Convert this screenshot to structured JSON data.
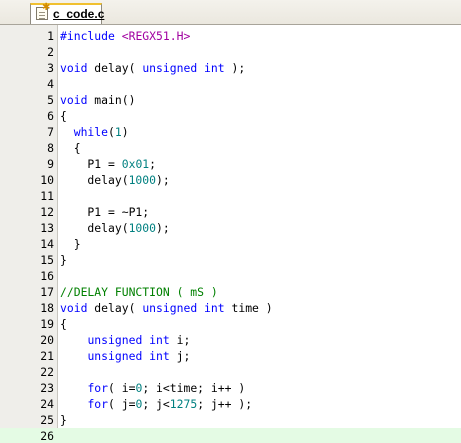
{
  "tab": {
    "label": "c_code.c"
  },
  "editor": {
    "current_line": 26,
    "lines": [
      {
        "n": "1",
        "tokens": [
          [
            "pp",
            "#include "
          ],
          [
            "str",
            "<REGX51.H>"
          ]
        ]
      },
      {
        "n": "2",
        "tokens": []
      },
      {
        "n": "3",
        "tokens": [
          [
            "kw",
            "void"
          ],
          [
            "txt",
            " delay( "
          ],
          [
            "kw",
            "unsigned"
          ],
          [
            "txt",
            " "
          ],
          [
            "kw",
            "int"
          ],
          [
            "txt",
            " );"
          ]
        ]
      },
      {
        "n": "4",
        "tokens": []
      },
      {
        "n": "5",
        "tokens": [
          [
            "kw",
            "void"
          ],
          [
            "txt",
            " main()"
          ]
        ]
      },
      {
        "n": "6",
        "tokens": [
          [
            "txt",
            "{"
          ]
        ]
      },
      {
        "n": "7",
        "tokens": [
          [
            "txt",
            "  "
          ],
          [
            "kw",
            "while"
          ],
          [
            "txt",
            "("
          ],
          [
            "num",
            "1"
          ],
          [
            "txt",
            ")"
          ]
        ]
      },
      {
        "n": "8",
        "tokens": [
          [
            "txt",
            "  {"
          ]
        ]
      },
      {
        "n": "9",
        "tokens": [
          [
            "txt",
            "    P1 = "
          ],
          [
            "num",
            "0x01"
          ],
          [
            "txt",
            ";"
          ]
        ]
      },
      {
        "n": "10",
        "tokens": [
          [
            "txt",
            "    delay("
          ],
          [
            "num",
            "1000"
          ],
          [
            "txt",
            ");"
          ]
        ]
      },
      {
        "n": "11",
        "tokens": []
      },
      {
        "n": "12",
        "tokens": [
          [
            "txt",
            "    P1 = ~P1;"
          ]
        ]
      },
      {
        "n": "13",
        "tokens": [
          [
            "txt",
            "    delay("
          ],
          [
            "num",
            "1000"
          ],
          [
            "txt",
            ");"
          ]
        ]
      },
      {
        "n": "14",
        "tokens": [
          [
            "txt",
            "  }"
          ]
        ]
      },
      {
        "n": "15",
        "tokens": [
          [
            "txt",
            "}"
          ]
        ]
      },
      {
        "n": "16",
        "tokens": []
      },
      {
        "n": "17",
        "tokens": [
          [
            "cmt",
            "//DELAY FUNCTION ( mS )"
          ]
        ]
      },
      {
        "n": "18",
        "tokens": [
          [
            "kw",
            "void"
          ],
          [
            "txt",
            " delay( "
          ],
          [
            "kw",
            "unsigned"
          ],
          [
            "txt",
            " "
          ],
          [
            "kw",
            "int"
          ],
          [
            "txt",
            " time )"
          ]
        ]
      },
      {
        "n": "19",
        "tokens": [
          [
            "txt",
            "{"
          ]
        ]
      },
      {
        "n": "20",
        "tokens": [
          [
            "txt",
            "    "
          ],
          [
            "kw",
            "unsigned"
          ],
          [
            "txt",
            " "
          ],
          [
            "kw",
            "int"
          ],
          [
            "txt",
            " i;"
          ]
        ]
      },
      {
        "n": "21",
        "tokens": [
          [
            "txt",
            "    "
          ],
          [
            "kw",
            "unsigned"
          ],
          [
            "txt",
            " "
          ],
          [
            "kw",
            "int"
          ],
          [
            "txt",
            " j;"
          ]
        ]
      },
      {
        "n": "22",
        "tokens": []
      },
      {
        "n": "23",
        "tokens": [
          [
            "txt",
            "    "
          ],
          [
            "kw",
            "for"
          ],
          [
            "txt",
            "( i="
          ],
          [
            "num",
            "0"
          ],
          [
            "txt",
            "; i<time; i++ )"
          ]
        ]
      },
      {
        "n": "24",
        "tokens": [
          [
            "txt",
            "    "
          ],
          [
            "kw",
            "for"
          ],
          [
            "txt",
            "( j="
          ],
          [
            "num",
            "0"
          ],
          [
            "txt",
            "; j<"
          ],
          [
            "num",
            "1275"
          ],
          [
            "txt",
            "; j++ );"
          ]
        ]
      },
      {
        "n": "25",
        "tokens": [
          [
            "txt",
            "}"
          ]
        ]
      },
      {
        "n": "26",
        "tokens": []
      }
    ]
  },
  "colors": {
    "keyword": "#0000ff",
    "number": "#008080",
    "comment": "#008000",
    "string": "#a000a0",
    "current_line_bg": "#e4fbe4",
    "tab_accent": "#f0c030"
  }
}
